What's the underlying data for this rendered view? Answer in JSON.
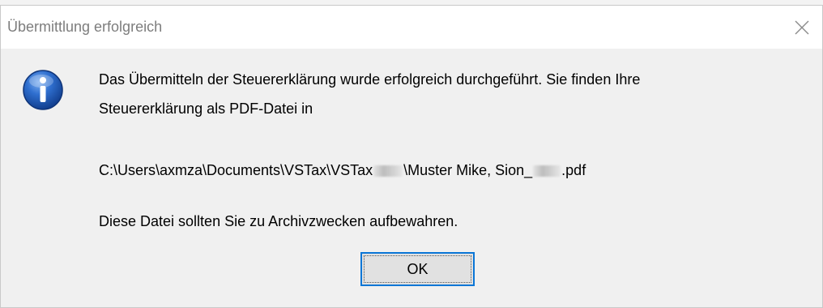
{
  "dialog": {
    "title": "Übermittlung erfolgreich",
    "close_icon": "close-icon",
    "icon": "info-icon",
    "colors": {
      "icon_blue": "#1e5fb8",
      "button_focus": "#0a76d6",
      "title_text": "#7d7d7d"
    },
    "message_line1": "Das Übermitteln der Steuererklärung wurde erfolgreich durchgeführt. Sie finden Ihre",
    "message_line2": "Steuererklärung als PDF-Datei in",
    "path_part1": "C:\\Users\\axmza\\Documents\\VSTax\\VSTax",
    "path_part2": "\\Muster Mike, Sion_",
    "path_part3": ".pdf",
    "message_line4": "Diese Datei sollten Sie zu Archivzwecken aufbewahren.",
    "ok_label": "OK"
  }
}
